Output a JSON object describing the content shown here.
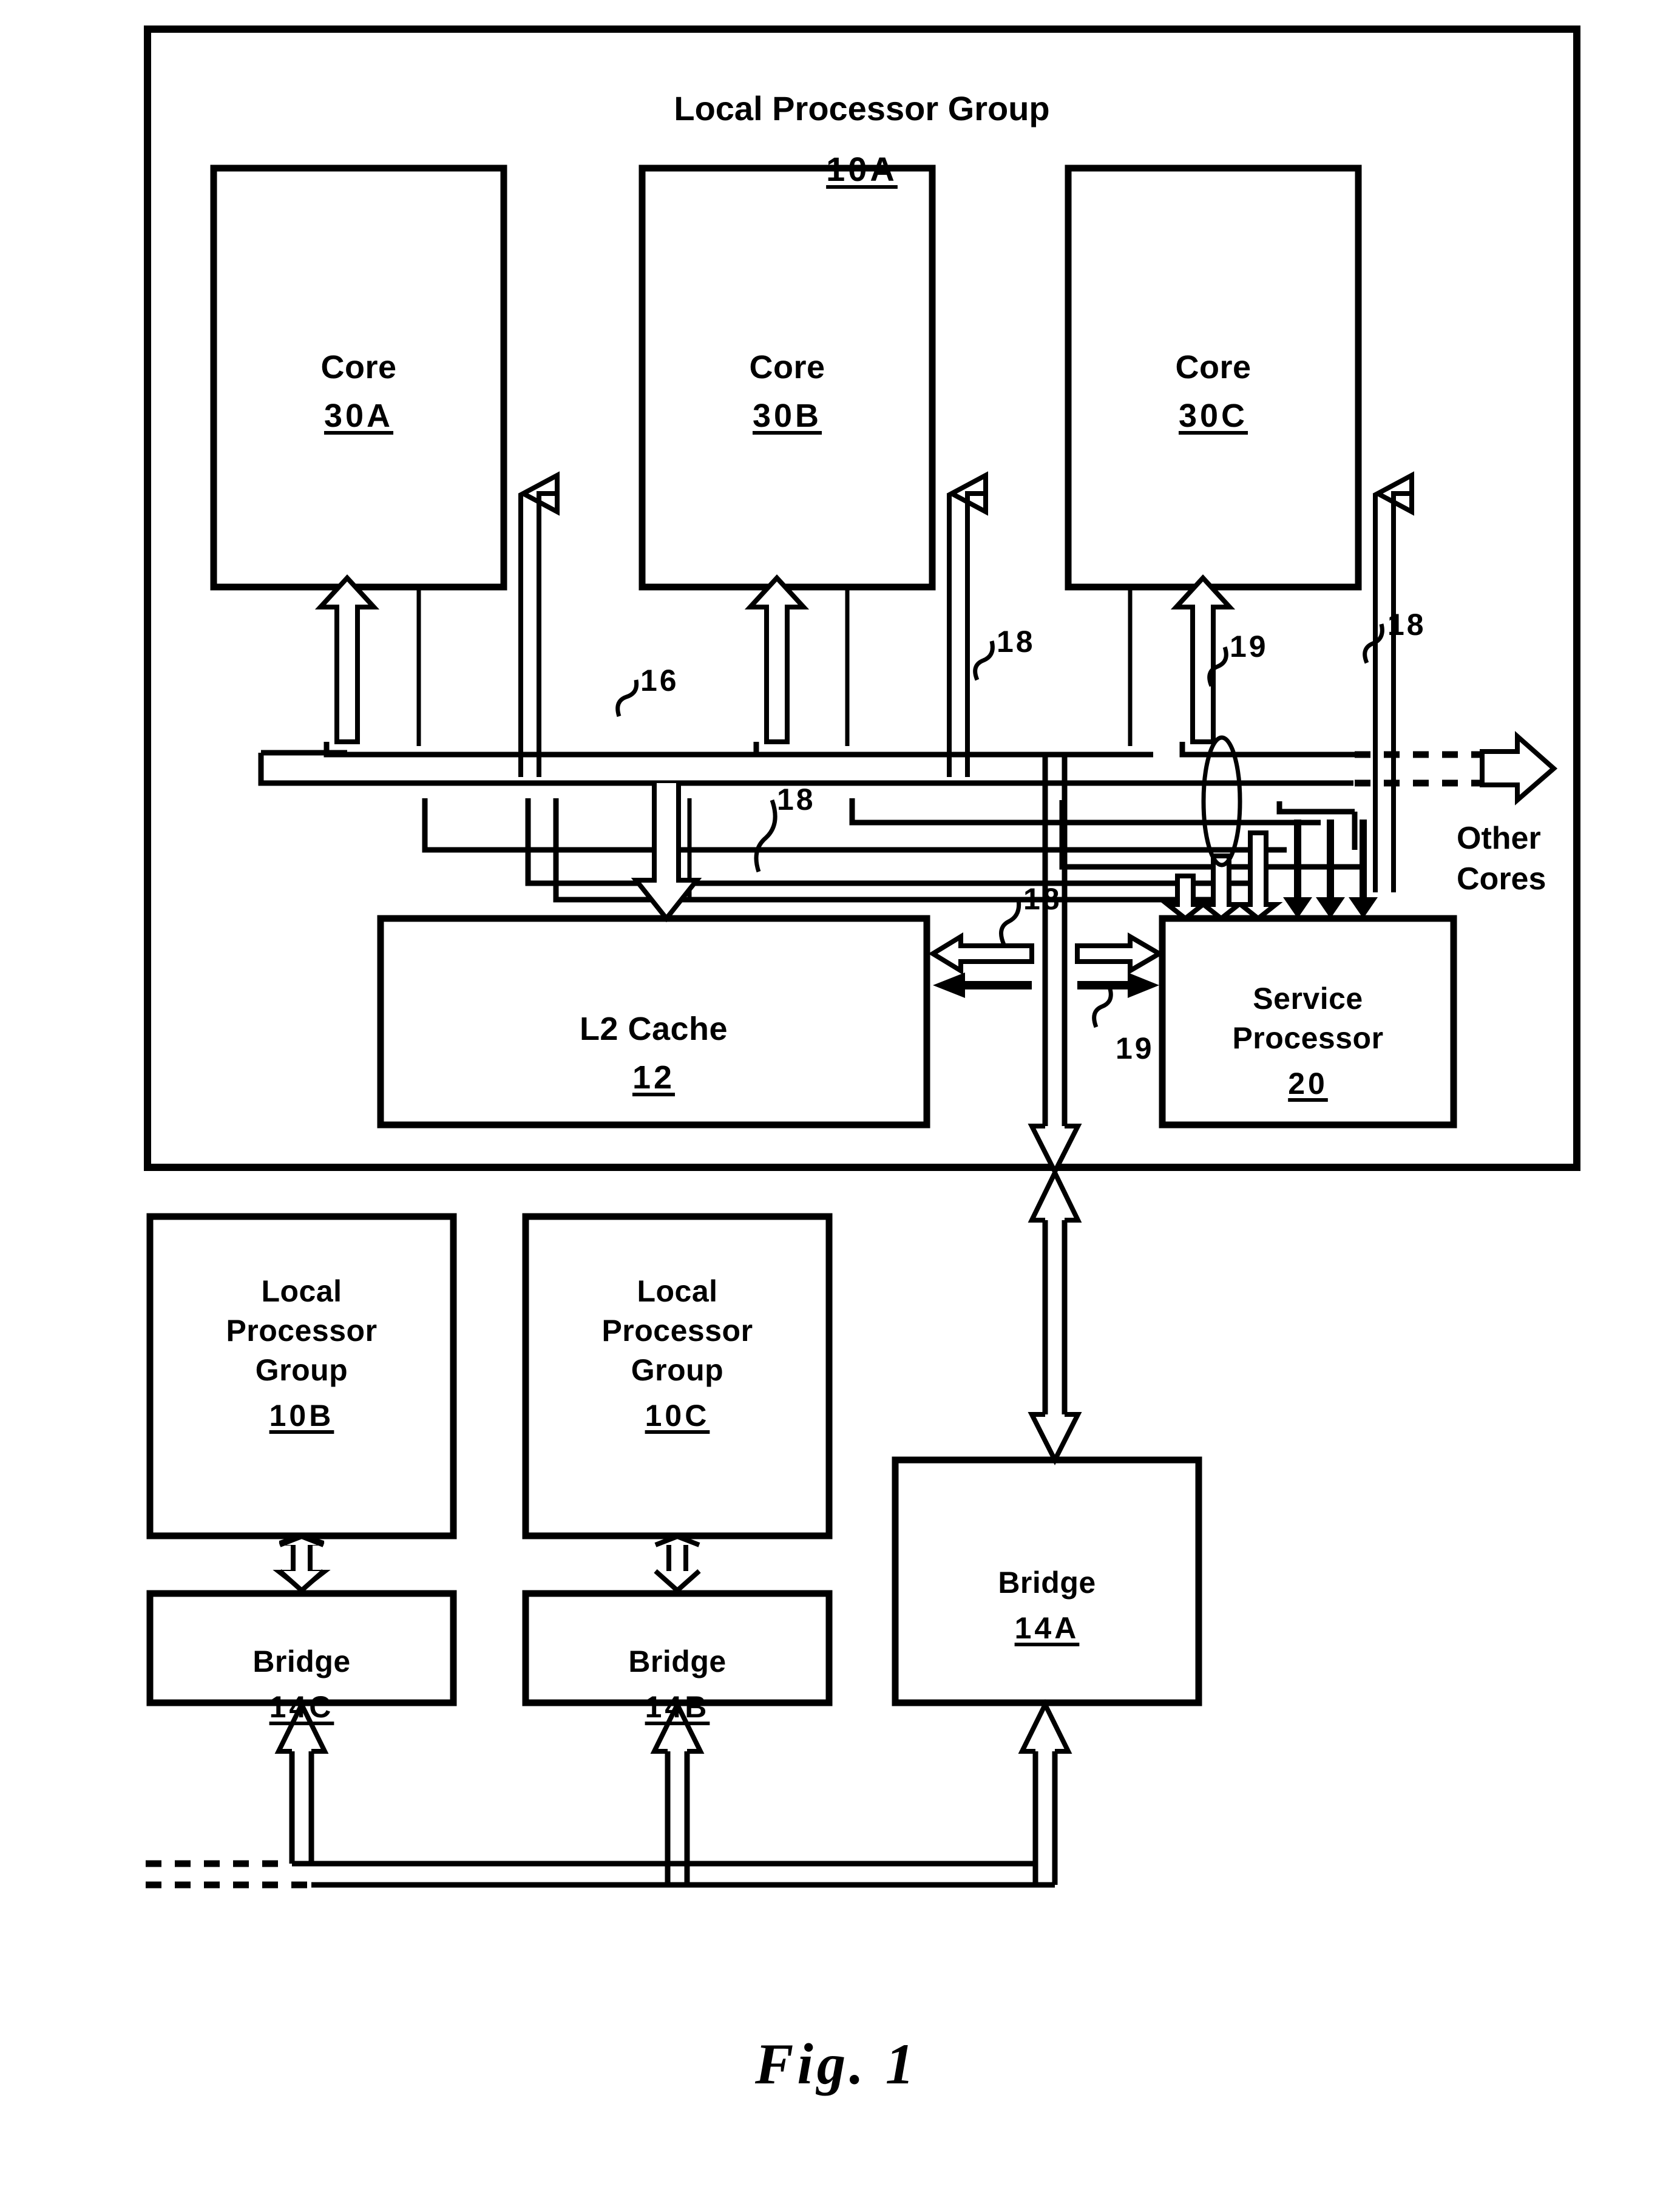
{
  "figure": {
    "caption": "Fig. 1",
    "title": "Local Processor Group",
    "title_ref": "10A"
  },
  "outer_group": {
    "name": "Local Processor Group",
    "ref": "10A"
  },
  "cores": [
    {
      "label": "Core",
      "ref": "30A"
    },
    {
      "label": "Core",
      "ref": "30B"
    },
    {
      "label": "Core",
      "ref": "30C"
    }
  ],
  "cache": {
    "label": "L2 Cache",
    "ref": "12"
  },
  "service_processor": {
    "label": "Service\nProcessor",
    "ref": "20"
  },
  "other_cores": {
    "label": "Other\nCores"
  },
  "peer_groups": [
    {
      "label": "Local\nProcessor\nGroup",
      "ref": "10B"
    },
    {
      "label": "Local\nProcessor\nGroup",
      "ref": "10C"
    }
  ],
  "bridges": [
    {
      "label": "Bridge",
      "ref": "14C"
    },
    {
      "label": "Bridge",
      "ref": "14B"
    },
    {
      "label": "Bridge",
      "ref": "14A"
    }
  ],
  "reference_numerals": [
    {
      "id": "n16",
      "text": "16"
    },
    {
      "id": "n18a",
      "text": "18"
    },
    {
      "id": "n18b",
      "text": "18"
    },
    {
      "id": "n18c",
      "text": "18"
    },
    {
      "id": "n18d",
      "text": "18"
    },
    {
      "id": "n18e",
      "text": "18"
    },
    {
      "id": "n19a",
      "text": "19"
    },
    {
      "id": "n19b",
      "text": "19"
    }
  ],
  "colors": {
    "ink": "#000000",
    "paper": "#ffffff"
  }
}
